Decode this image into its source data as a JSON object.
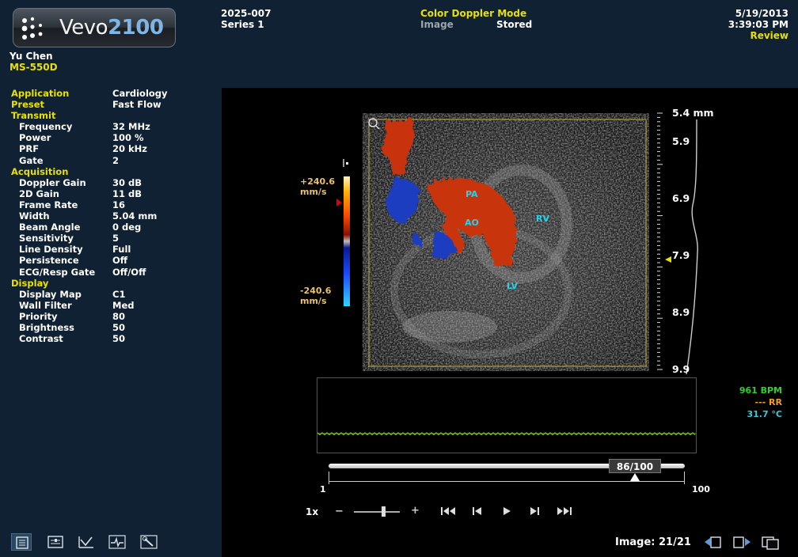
{
  "logo": {
    "brand": "Vevo",
    "model": "2100"
  },
  "user": {
    "name": "Yu Chen",
    "transducer": "MS-550D"
  },
  "study": {
    "id": "2025-007",
    "series": "Series 1"
  },
  "mode": {
    "title": "Color Doppler Mode",
    "image_label": "Image",
    "image_status": "Stored"
  },
  "datetime": {
    "date": "5/19/2013",
    "time": "3:39:03 PM",
    "status": "Review"
  },
  "params": [
    {
      "label": "Application",
      "value": "Cardiology",
      "kind": "top"
    },
    {
      "label": "Preset",
      "value": "Fast Flow",
      "kind": "top"
    },
    {
      "label": "Transmit",
      "value": "",
      "kind": "head"
    },
    {
      "label": "Frequency",
      "value": "32 MHz",
      "kind": "sub"
    },
    {
      "label": "Power",
      "value": "100 %",
      "kind": "sub"
    },
    {
      "label": "PRF",
      "value": "20 kHz",
      "kind": "sub"
    },
    {
      "label": "Gate",
      "value": "2",
      "kind": "sub"
    },
    {
      "label": "Acquisition",
      "value": "",
      "kind": "head"
    },
    {
      "label": "Doppler Gain",
      "value": "30 dB",
      "kind": "sub"
    },
    {
      "label": "2D Gain",
      "value": "11 dB",
      "kind": "sub"
    },
    {
      "label": "Frame Rate",
      "value": "16",
      "kind": "sub"
    },
    {
      "label": "Width",
      "value": "5.04 mm",
      "kind": "sub"
    },
    {
      "label": "Beam Angle",
      "value": "0 deg",
      "kind": "sub"
    },
    {
      "label": "Sensitivity",
      "value": "5",
      "kind": "sub"
    },
    {
      "label": "Line Density",
      "value": "Full",
      "kind": "sub"
    },
    {
      "label": "Persistence",
      "value": "Off",
      "kind": "sub"
    },
    {
      "label": "ECG/Resp Gate",
      "value": "Off/Off",
      "kind": "sub"
    },
    {
      "label": "Display",
      "value": "",
      "kind": "head"
    },
    {
      "label": "Display Map",
      "value": "C1",
      "kind": "sub"
    },
    {
      "label": "Wall Filter",
      "value": "Med",
      "kind": "sub"
    },
    {
      "label": "Priority",
      "value": "80",
      "kind": "sub"
    },
    {
      "label": "Brightness",
      "value": "50",
      "kind": "sub"
    },
    {
      "label": "Contrast",
      "value": "50",
      "kind": "sub"
    }
  ],
  "colorbar": {
    "max": "+240.6",
    "min": "-240.6",
    "unit": "mm/s"
  },
  "depth_scale": {
    "labels": [
      "5.4 mm",
      "5.9",
      "6.9",
      "7.9",
      "8.9",
      "9.9"
    ]
  },
  "annotations": {
    "pa": "PA",
    "ao": "AO",
    "rv": "RV",
    "lv": "LV"
  },
  "vitals": {
    "bpm": "961 BPM",
    "rr": "--- RR",
    "temp": "31.7 °C"
  },
  "cine": {
    "frame_readout": "86/100",
    "min": "1",
    "max": "100",
    "position": 0.86,
    "speed": "1x",
    "minus": "−",
    "plus": "+"
  },
  "footer": {
    "image_count": "Image: 21/21"
  },
  "colors": {
    "label_yellow": "#e8e000",
    "panel_bg": "#0f2132",
    "vital_green": "#2fd02f",
    "vital_orange": "#f0a020",
    "vital_cyan": "#3ec7d8",
    "annot_cyan": "#2ad0e8"
  },
  "icons": [
    "patient-list-icon",
    "measurement-icon",
    "analysis-icon",
    "ecg-icon",
    "tools-icon",
    "prev-image-icon",
    "next-image-icon",
    "layout-icon",
    "first-frame-icon",
    "prev-frame-icon",
    "play-icon",
    "next-frame-icon",
    "last-frame-icon"
  ]
}
